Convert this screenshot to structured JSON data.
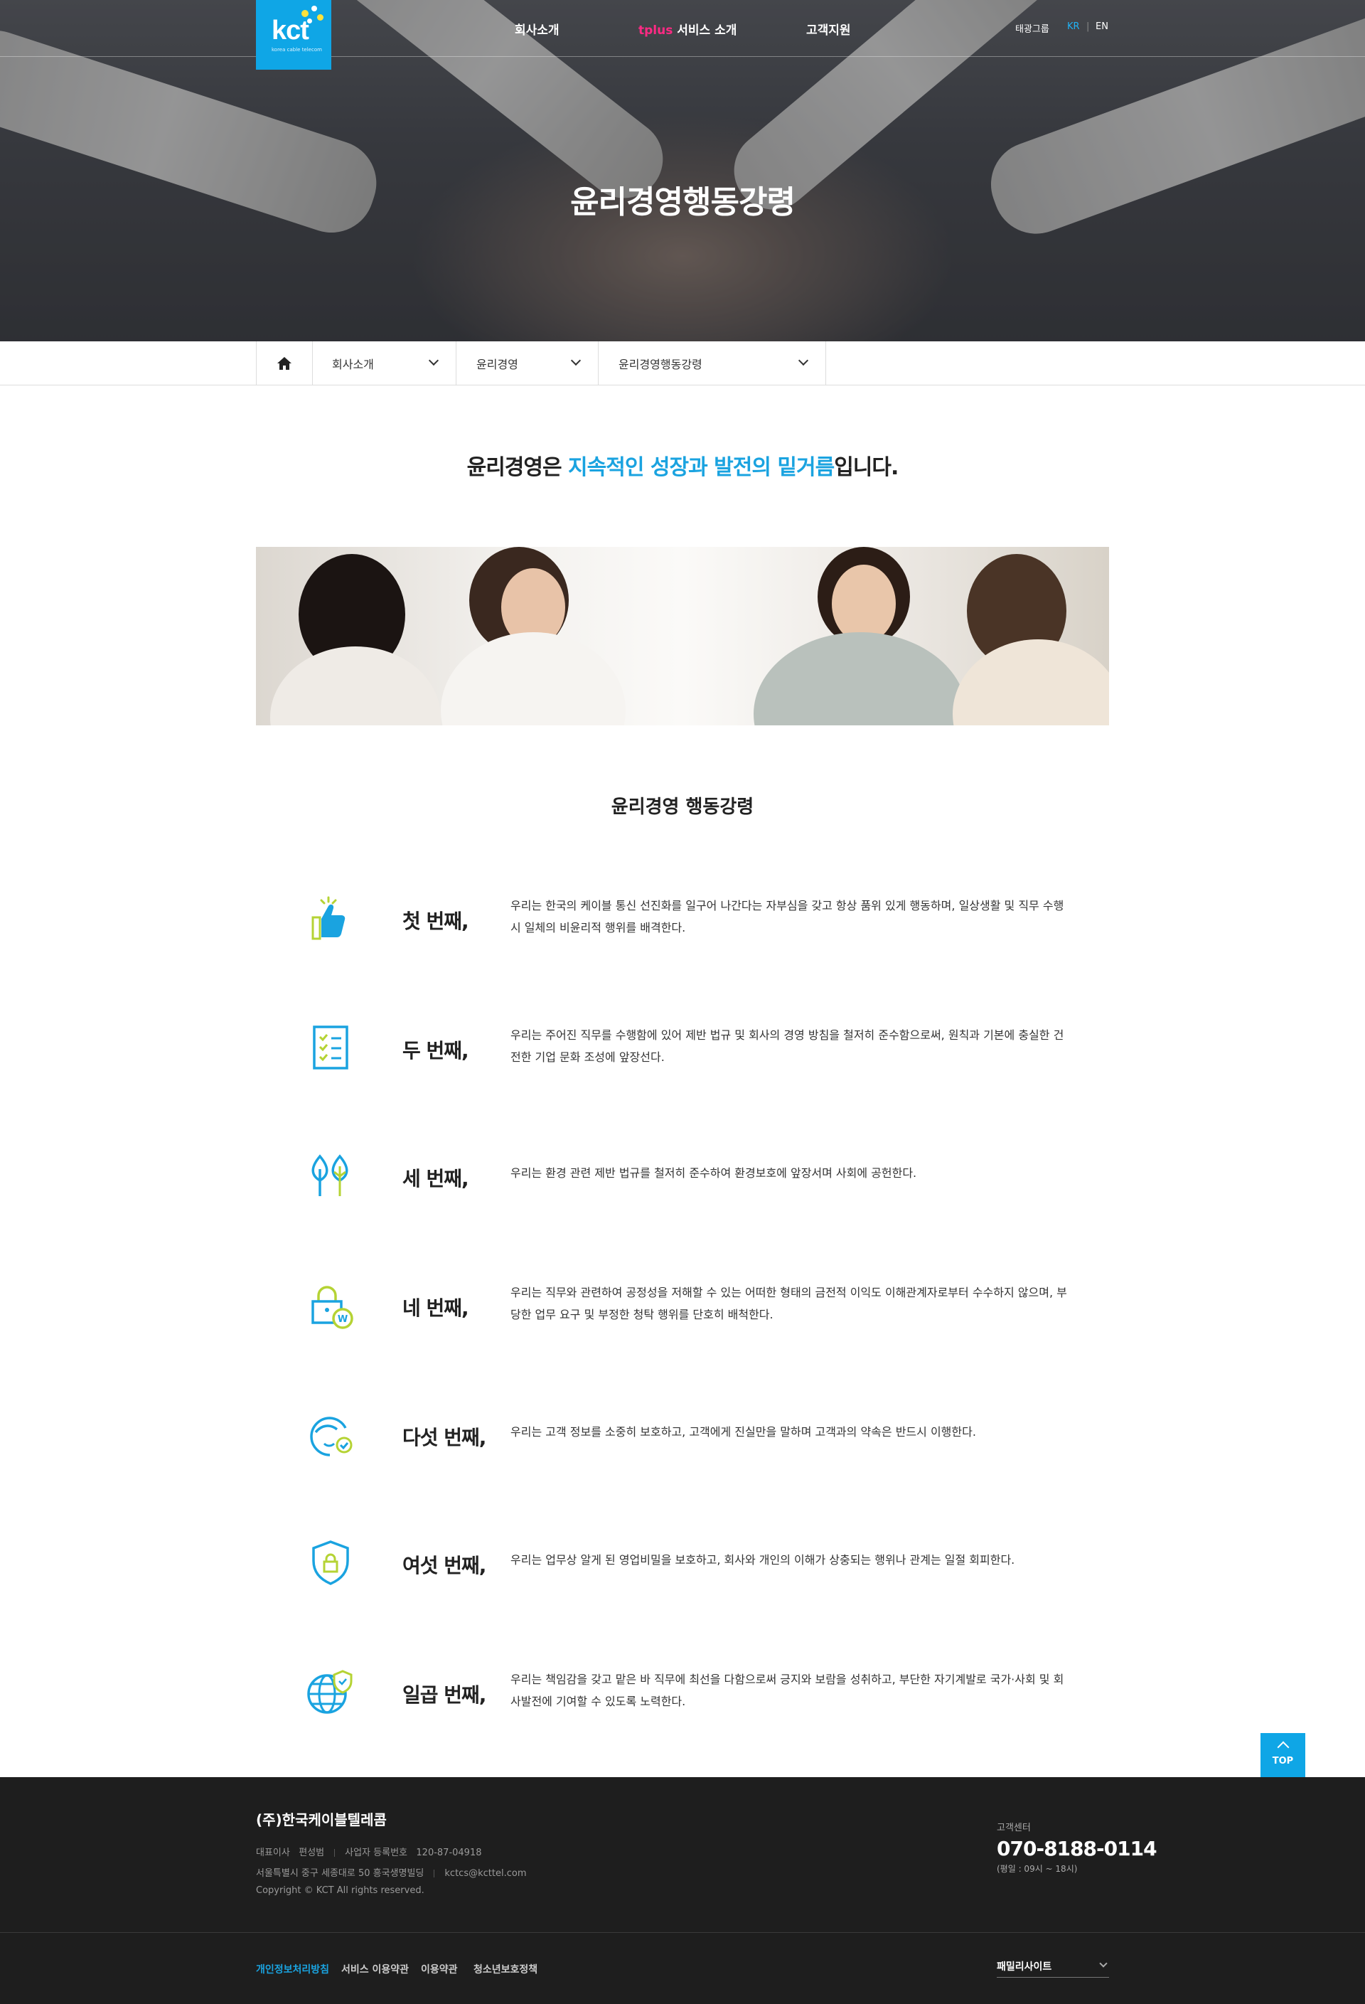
{
  "header": {
    "logo_text": "kct",
    "logo_sub": "korea cable telecom",
    "nav": [
      {
        "label": "회사소개"
      },
      {
        "prefix": "tplus",
        "label": " 서비스 소개"
      },
      {
        "label": "고객지원"
      }
    ],
    "util": {
      "group": "태광그룹",
      "kr": "KR",
      "en": "EN"
    }
  },
  "hero": {
    "title": "윤리경영행동강령"
  },
  "breadcrumb": {
    "home_icon": "home-icon",
    "items": [
      "회사소개",
      "윤리경영",
      "윤리경영행동강령"
    ]
  },
  "intro": {
    "pre": "윤리경영은 ",
    "highlight": "지속적인 성장과 발전의 밑거름",
    "post": "입니다."
  },
  "section": {
    "title": "윤리경영 행동강령"
  },
  "codes": [
    {
      "icon": "thumbs-up-icon",
      "ordinal": "첫 번째,",
      "text": "우리는 한국의 케이블 통신 선진화를 일구어 나간다는 자부심을 갖고 항상 품위 있게 행동하며, 일상생활 및 직무 수행 시 일체의 비윤리적 행위를 배격한다."
    },
    {
      "icon": "checklist-icon",
      "ordinal": "두 번째,",
      "text": "우리는 주어진 직무를 수행함에 있어 제반 법규 및 회사의 경영 방침을 철저히 준수함으로써, 원칙과 기본에 충실한 건전한 기업 문화 조성에 앞장선다."
    },
    {
      "icon": "trees-icon",
      "ordinal": "세 번째,",
      "text": "우리는 환경 관련 제반 법규를 철저히 준수하여 환경보호에 앞장서며 사회에 공헌한다."
    },
    {
      "icon": "lock-won-icon",
      "ordinal": "네 번째,",
      "text": "우리는 직무와 관련하여 공정성을 저해할 수 있는 어떠한 형태의 금전적 이익도 이해관계자로부터 수수하지 않으며, 부당한 업무 요구 및 부정한 청탁 행위를 단호히 배척한다."
    },
    {
      "icon": "customer-check-icon",
      "ordinal": "다섯 번째,",
      "text": "우리는 고객 정보를 소중히 보호하고, 고객에게 진실만을 말하며 고객과의 약속은 반드시 이행한다."
    },
    {
      "icon": "shield-lock-icon",
      "ordinal": "여섯 번째,",
      "text": "우리는 업무상 알게 된 영업비밀을 보호하고, 회사와 개인의 이해가 상충되는 행위나 관계는 일절 회피한다."
    },
    {
      "icon": "globe-shield-icon",
      "ordinal": "일곱 번째,",
      "text": "우리는 책임감을 갖고 맡은 바 직무에 최선을 다함으로써 긍지와 보람을 성취하고, 부단한 자기계발로 국가·사회 및 회사발전에 기여할 수 있도록 노력한다."
    }
  ],
  "top_button": "TOP",
  "footer": {
    "company": "(주)한국케이블텔레콤",
    "ceo_label": "대표이사",
    "ceo": "편성범",
    "biz_label": "사업자 등록번호",
    "biz_no": "120-87-04918",
    "address": "서울특별시 중구 세종대로 50 흥국생명빌딩",
    "email": "kctcs@kcttel.com",
    "copyright": "Copyright © KCT All rights reserved.",
    "cs_label": "고객센터",
    "phone": "070-8188-0114",
    "hours": "(평일 : 09시 ~ 18시)",
    "links": [
      "개인정보처리방침",
      "서비스 이용약관",
      "이용약관",
      "청소년보호정책"
    ],
    "family_site": "패밀리사이트"
  },
  "colors": {
    "accent": "#0fa6e6",
    "highlight": "#1aa3e0",
    "pink": "#ff2a84",
    "icon_lime": "#b5d334",
    "footer_bg": "#1e1e1e"
  }
}
